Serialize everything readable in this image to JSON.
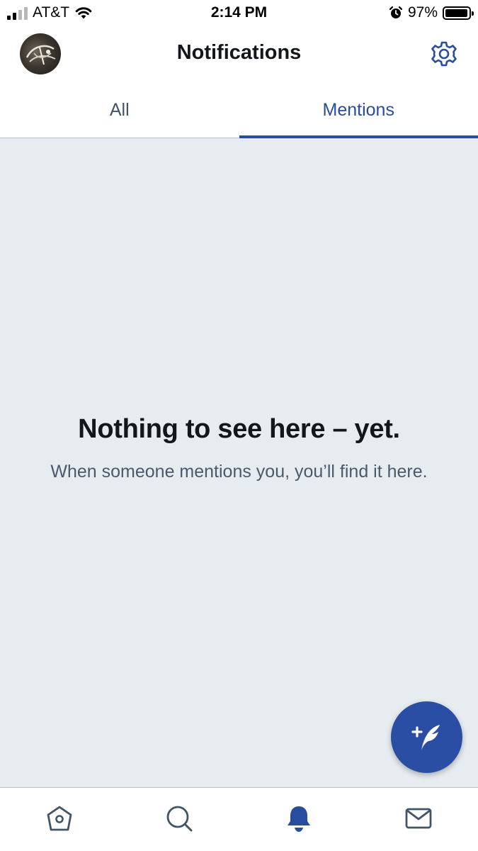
{
  "status_bar": {
    "carrier": "AT&T",
    "time": "2:14 PM",
    "battery": "97%",
    "battery_level": 0.97,
    "signal_bars": 2,
    "icons": [
      "signal-icon",
      "wifi-icon",
      "alarm-icon",
      "battery-icon"
    ]
  },
  "header": {
    "title": "Notifications",
    "avatar_icon": "profile-avatar",
    "settings_icon": "gear-icon"
  },
  "tabs": [
    {
      "label": "All",
      "active": false
    },
    {
      "label": "Mentions",
      "active": true
    }
  ],
  "empty_state": {
    "title": "Nothing to see here – yet.",
    "subtitle": "When someone mentions you, you’ll find it here."
  },
  "compose_button": {
    "icon": "compose-feather-plus-icon"
  },
  "bottom_nav": [
    {
      "name": "home",
      "icon": "home-icon",
      "active": false
    },
    {
      "name": "search",
      "icon": "search-icon",
      "active": false
    },
    {
      "name": "notifications",
      "icon": "bell-icon",
      "active": true
    },
    {
      "name": "messages",
      "icon": "mail-icon",
      "active": false
    }
  ],
  "colors": {
    "accent": "#284d9e",
    "fab": "#2a4ea3",
    "background": "#e6ecf0",
    "title_text": "#14171a",
    "secondary_text": "#4a5a6a"
  }
}
